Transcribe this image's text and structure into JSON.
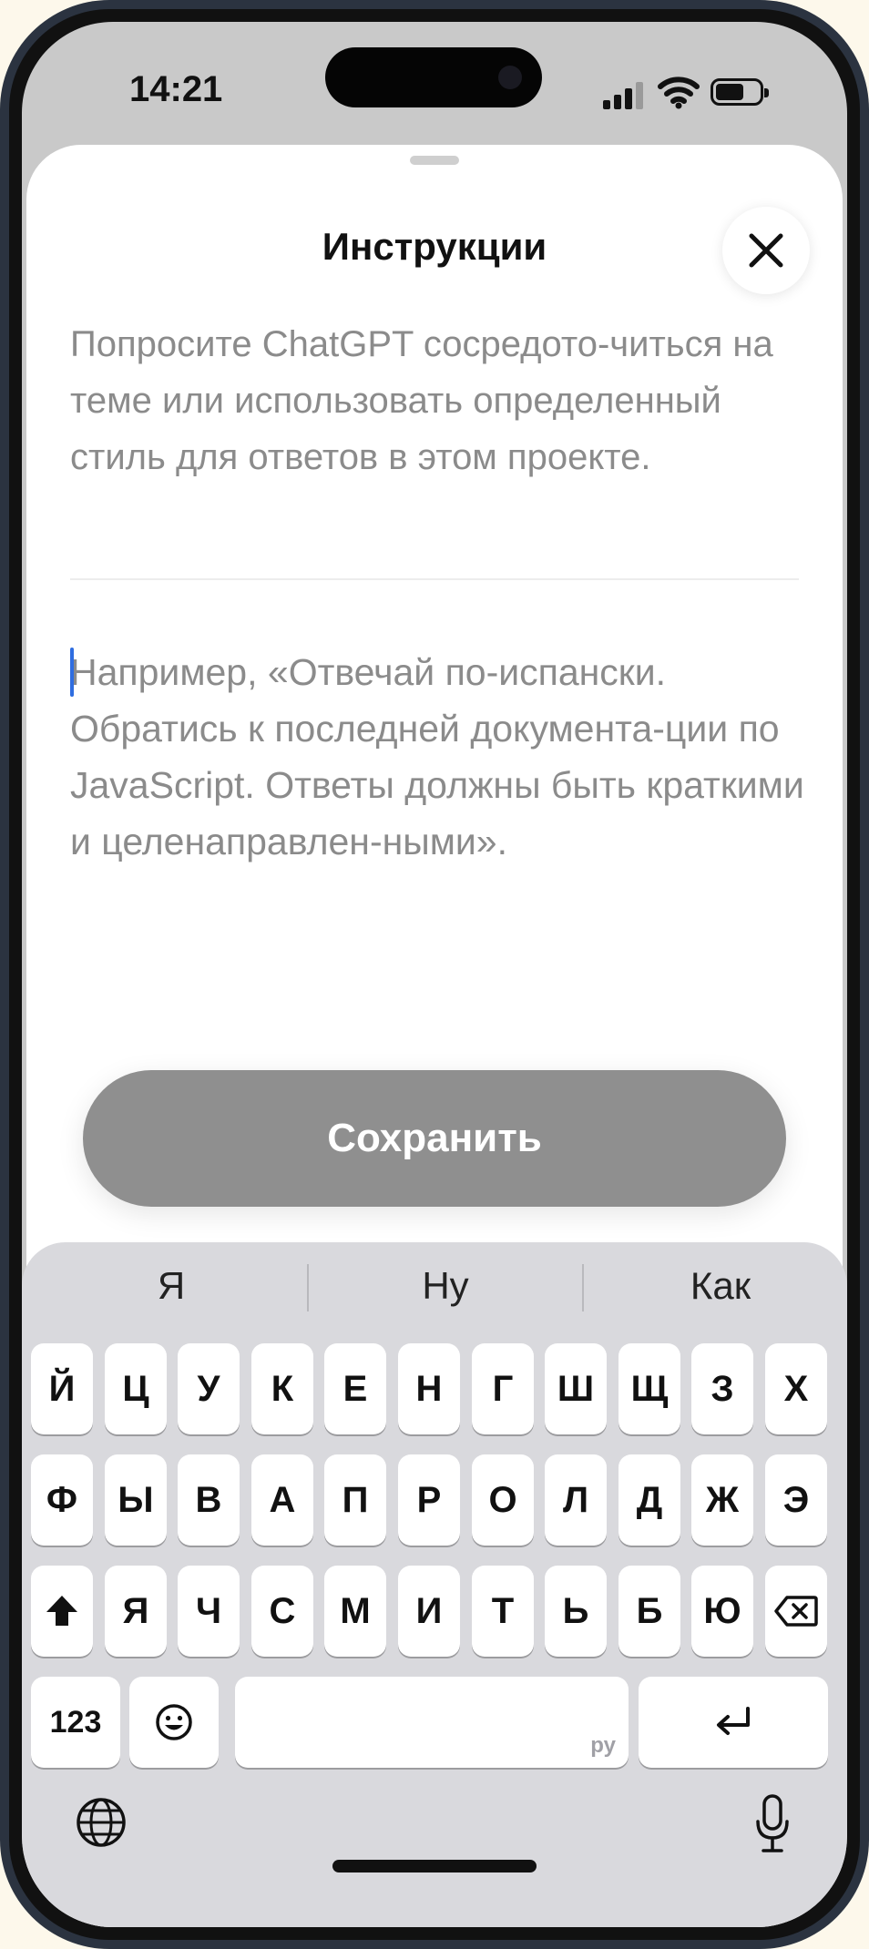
{
  "status_bar": {
    "time": "14:21"
  },
  "sheet": {
    "title": "Инструкции",
    "description": "Попросите ChatGPT сосредото-читься на теме или использовать определенный стиль для ответов в этом проекте.",
    "input_value": "",
    "input_placeholder": "Например, «Отвечай по-испански. Обратись к последней документа-ции по JavaScript. Ответы должны быть краткими и целенаправлен-ными».",
    "save_label": "Сохранить"
  },
  "keyboard": {
    "suggestions": [
      "Я",
      "Ну",
      "Как"
    ],
    "row1": [
      "Й",
      "Ц",
      "У",
      "К",
      "Е",
      "Н",
      "Г",
      "Ш",
      "Щ",
      "З",
      "Х"
    ],
    "row2": [
      "Ф",
      "Ы",
      "В",
      "А",
      "П",
      "Р",
      "О",
      "Л",
      "Д",
      "Ж",
      "Э"
    ],
    "row3": [
      "Я",
      "Ч",
      "С",
      "М",
      "И",
      "Т",
      "Ь",
      "Б",
      "Ю"
    ],
    "numbers_label": "123",
    "space_hint": "ру"
  }
}
